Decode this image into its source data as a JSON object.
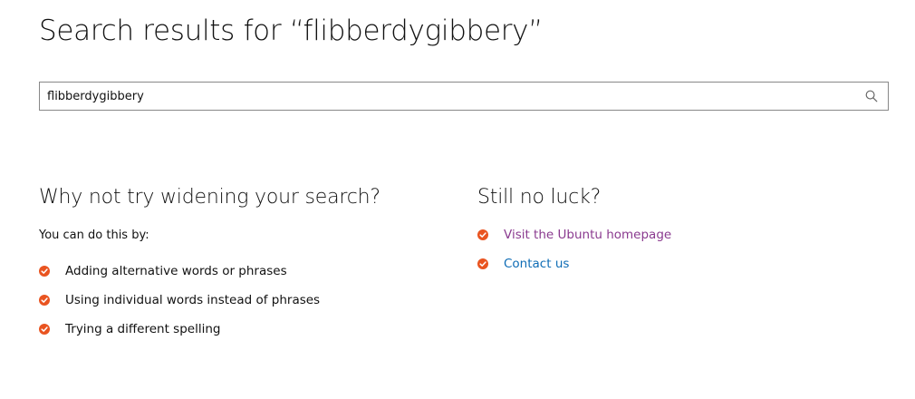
{
  "page": {
    "title": "Search results for “flibberdygibbery”"
  },
  "search": {
    "value": "flibberdygibbery",
    "button_icon": "search-icon"
  },
  "widen": {
    "heading": "Why not try widening your search?",
    "intro": "You can do this by:",
    "items": [
      "Adding alternative words or phrases",
      "Using individual words instead of phrases",
      "Trying a different spelling"
    ]
  },
  "luck": {
    "heading": "Still no luck?",
    "links": [
      {
        "label": "Visit the Ubuntu homepage",
        "color": "#8a3a8f"
      },
      {
        "label": "Contact us",
        "color": "#0e6cb5"
      }
    ]
  },
  "colors": {
    "tick": "#e95420",
    "link_visited": "#8a3a8f",
    "link": "#0e6cb5"
  }
}
